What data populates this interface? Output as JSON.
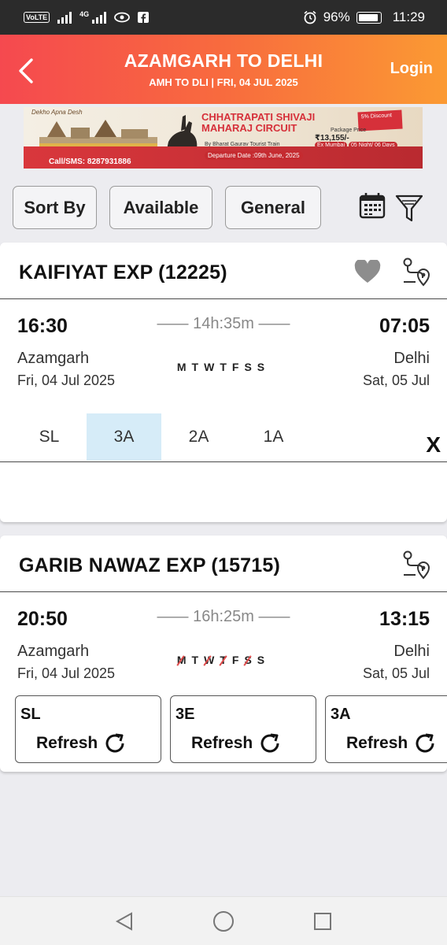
{
  "status_bar": {
    "volte": "VoLTE",
    "network": "4G",
    "battery": "96%",
    "time": "11:29"
  },
  "header": {
    "title": "AZAMGARH TO DELHI",
    "subtitle": "AMH TO DLI | FRI, 04 JUL  2025",
    "login": "Login"
  },
  "banner": {
    "heads": "Dekho Apna Desh",
    "title_line1": "CHHATRAPATI SHIVAJI",
    "title_line2": "MAHARAJ CIRCUIT",
    "discount": "5% Discount",
    "price_label": "Package Price",
    "price": "₹13,155/-",
    "by": "By Bharat Gaurav Tourist Train",
    "pill1": "Ex Mumbai",
    "pill2": "05 Night/ 06 Days",
    "departure": "Departure Date :09th June, 2025",
    "call": "Call/SMS: 8287931886"
  },
  "filters": {
    "sort_by": "Sort By",
    "available": "Available",
    "general": "General"
  },
  "trains": [
    {
      "name": "KAIFIYAT EXP (12225)",
      "dep_time": "16:30",
      "arr_time": "07:05",
      "duration": "—— 14h:35m ——",
      "from": "Azamgarh",
      "to": "Delhi",
      "dep_date": "Fri, 04 Jul  2025",
      "arr_date": "Sat, 05 Jul",
      "days": [
        "M",
        "T",
        "W",
        "T",
        "F",
        "S",
        "S"
      ],
      "classes": [
        "SL",
        "3A",
        "2A",
        "1A"
      ],
      "active_class": "3A",
      "close": "X"
    },
    {
      "name": "GARIB NAWAZ EXP (15715)",
      "dep_time": "20:50",
      "arr_time": "13:15",
      "duration": "—— 16h:25m ——",
      "from": "Azamgarh",
      "to": "Delhi",
      "dep_date": "Fri, 04 Jul  2025",
      "arr_date": "Sat, 05 Jul",
      "days": [
        "M",
        "T",
        "W",
        "T",
        "F",
        "S",
        "S"
      ],
      "running_days": [
        "T",
        "F",
        "S"
      ],
      "availability": [
        {
          "cls": "SL",
          "action": "Refresh"
        },
        {
          "cls": "3E",
          "action": "Refresh"
        },
        {
          "cls": "3A",
          "action": "Refresh"
        }
      ]
    }
  ]
}
